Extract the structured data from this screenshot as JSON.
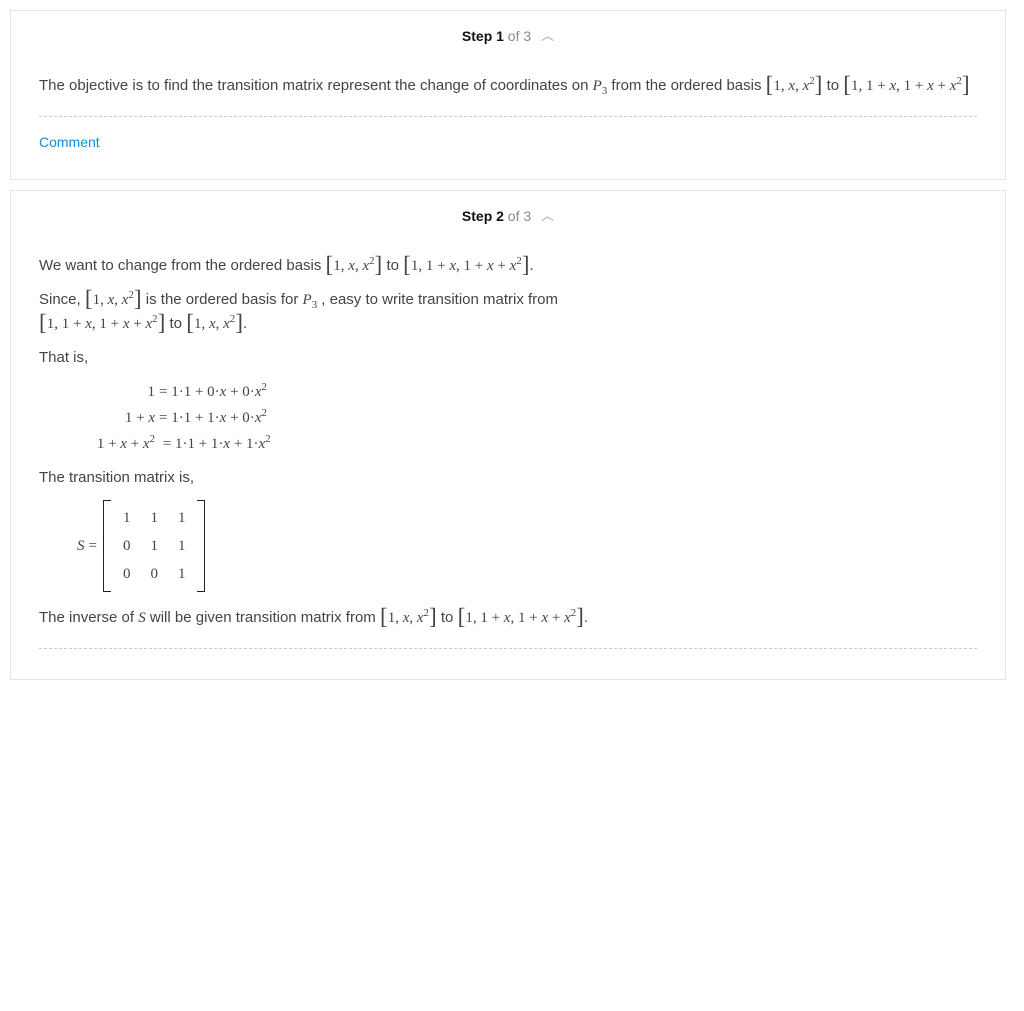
{
  "step1": {
    "label_strong": "Step 1",
    "label_rest": " of 3",
    "text1a": "The objective is to find the transition matrix represent the change of coordinates on ",
    "text1b": " from the ordered basis ",
    "text1c": " to ",
    "comment": "Comment"
  },
  "step2": {
    "label_strong": "Step 2",
    "label_rest": " of 3",
    "line1a": "We want to change from the ordered basis ",
    "line1b": " to ",
    "line1c": ".",
    "line2a": "Since, ",
    "line2b": " is the ordered basis for ",
    "line2c": " , easy to write transition matrix from ",
    "line2d": " to ",
    "line2e": ".",
    "thatis": "That is,",
    "eq1_lhs": "1",
    "eq1_rhs": " = 1·1 + 0·x + 0·x²",
    "eq2_lhs": "1 + x",
    "eq2_rhs": " = 1·1 + 1·x + 0·x²",
    "eq3_lhs": "1 + x + x²",
    "eq3_rhs": " = 1·1 + 1·x + 1·x²",
    "transtext": "The transition matrix is,",
    "matrix_lhs": "S = ",
    "m": [
      [
        "1",
        "1",
        "1"
      ],
      [
        "0",
        "1",
        "1"
      ],
      [
        "0",
        "0",
        "1"
      ]
    ],
    "invtext_a": "The inverse of ",
    "invtext_b": " will be given transition matrix from ",
    "invtext_c": " to ",
    "invtext_d": "."
  },
  "sym": {
    "basis_std_open": "[",
    "basis_std_content": "1, x, x²",
    "basis_std_close": "]",
    "basis_new_content": "1, 1 + x, 1 + x + x²",
    "P3": "P",
    "P3_sub": "3",
    "S": "S"
  }
}
